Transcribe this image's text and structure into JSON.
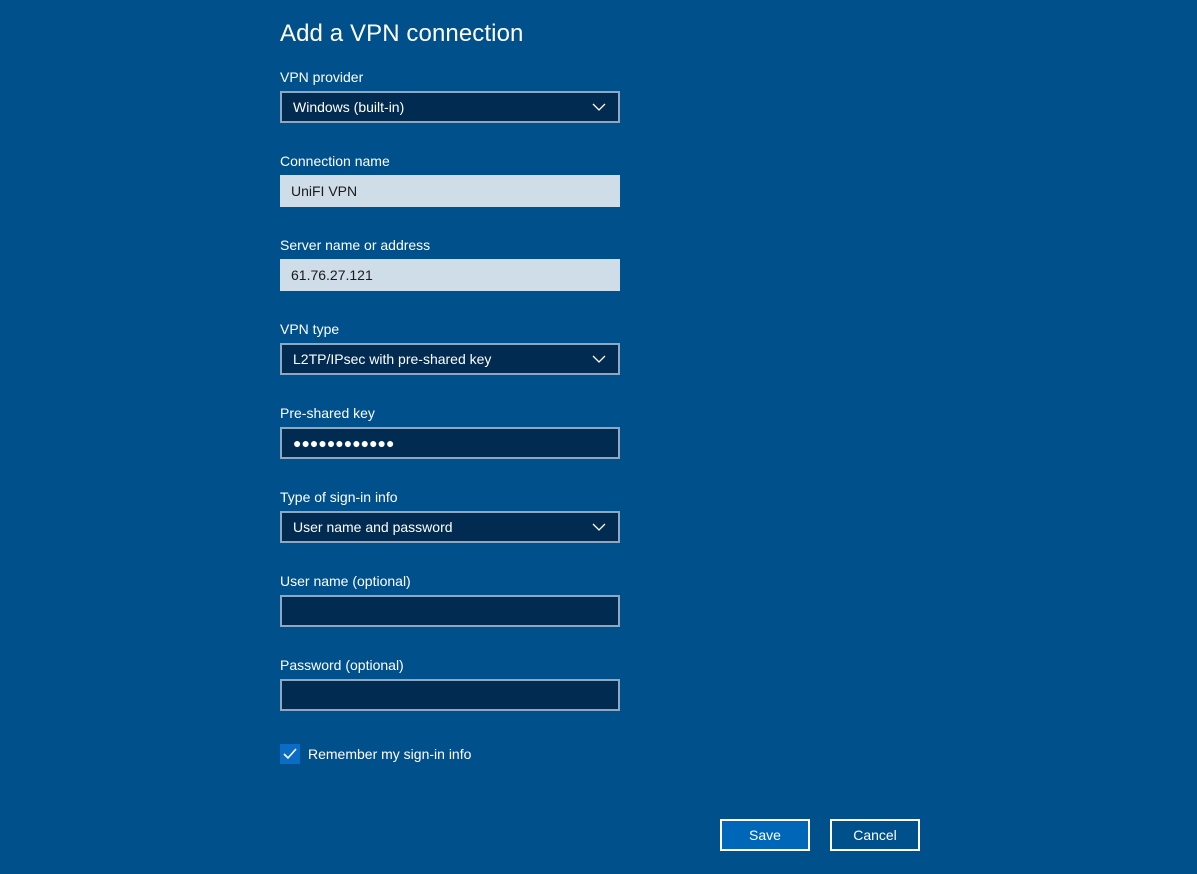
{
  "dialog": {
    "title": "Add a VPN connection"
  },
  "fields": {
    "vpn_provider": {
      "label": "VPN provider",
      "value": "Windows (built-in)"
    },
    "connection_name": {
      "label": "Connection name",
      "value": "UniFI VPN"
    },
    "server": {
      "label": "Server name or address",
      "value": "61.76.27.121"
    },
    "vpn_type": {
      "label": "VPN type",
      "value": "L2TP/IPsec with pre-shared key"
    },
    "pre_shared_key": {
      "label": "Pre-shared key",
      "masked_value": "●●●●●●●●●●●●"
    },
    "sign_in_type": {
      "label": "Type of sign-in info",
      "value": "User name and password"
    },
    "user_name": {
      "label": "User name (optional)",
      "value": ""
    },
    "password": {
      "label": "Password (optional)",
      "value": ""
    }
  },
  "remember": {
    "label": "Remember my sign-in info",
    "checked": true
  },
  "buttons": {
    "save": "Save",
    "cancel": "Cancel"
  },
  "colors": {
    "background": "#00508c",
    "input_dark": "#012b50",
    "input_light": "#cfdde9",
    "accent": "#0067b8"
  },
  "icons": {
    "dropdown": "chevron-down-icon",
    "checkmark": "checkmark-icon"
  }
}
